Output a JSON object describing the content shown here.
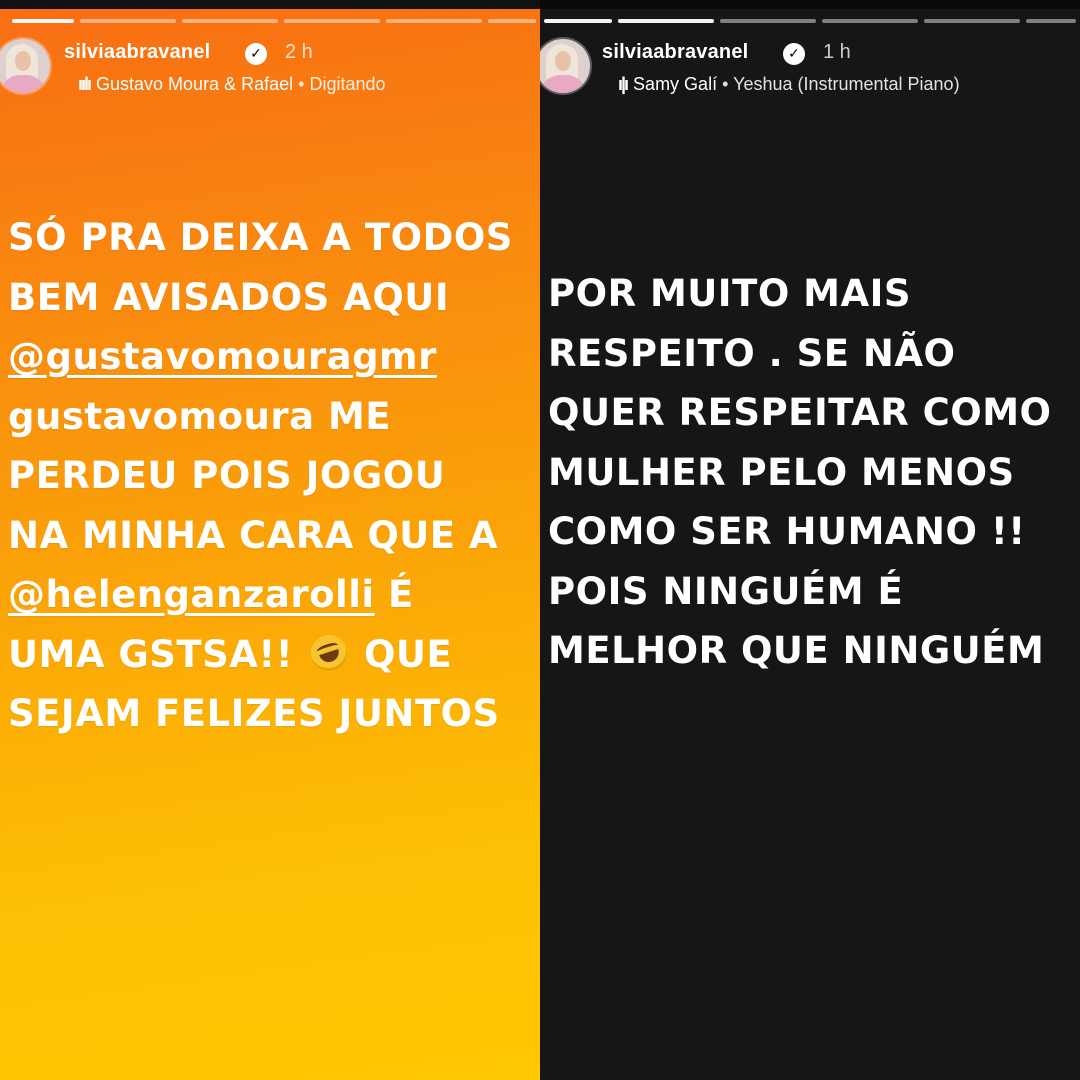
{
  "stories": [
    {
      "username": "silviaabravanel",
      "verified_icon": "verified-badge-icon",
      "time": "2 h",
      "music": {
        "icon": "audio-bars-icon",
        "artist": "Gustavo Moura & Rafael",
        "separator": "•",
        "track": "Digitando"
      },
      "text_lines": [
        "SÓ PRA DEIXA A TODOS",
        "BEM AVISADOS AQUI",
        "@gustavomouragmr",
        "gustavomoura ME",
        "PERDEU POIS JOGOU",
        "NA MINHA CARA QUE A",
        "@helenganzarolli",
        "É",
        "UMA GSTSA!!",
        "QUE",
        "SEJAM FELIZES JUNTOS"
      ],
      "emoji": "rolling-on-floor-laughing-emoji"
    },
    {
      "username": "silviaabravanel",
      "verified_icon": "verified-badge-icon",
      "time": "1 h",
      "music": {
        "icon": "audio-bars-icon",
        "artist": "Samy Galí",
        "separator": "•",
        "track": "Yeshua (Instrumental Piano)"
      },
      "text_lines": [
        "POR MUITO MAIS",
        "RESPEITO . SE NÃO",
        "QUER RESPEITAR COMO",
        "MULHER PELO MENOS",
        "COMO SER HUMANO !!",
        "POIS NINGUÉM É",
        "MELHOR QUE NINGUÉM"
      ]
    }
  ],
  "colors": {
    "left_gradient_top": "#f86d14",
    "left_gradient_bottom": "#fec802",
    "right_background": "#161616",
    "text": "#ffffff"
  }
}
